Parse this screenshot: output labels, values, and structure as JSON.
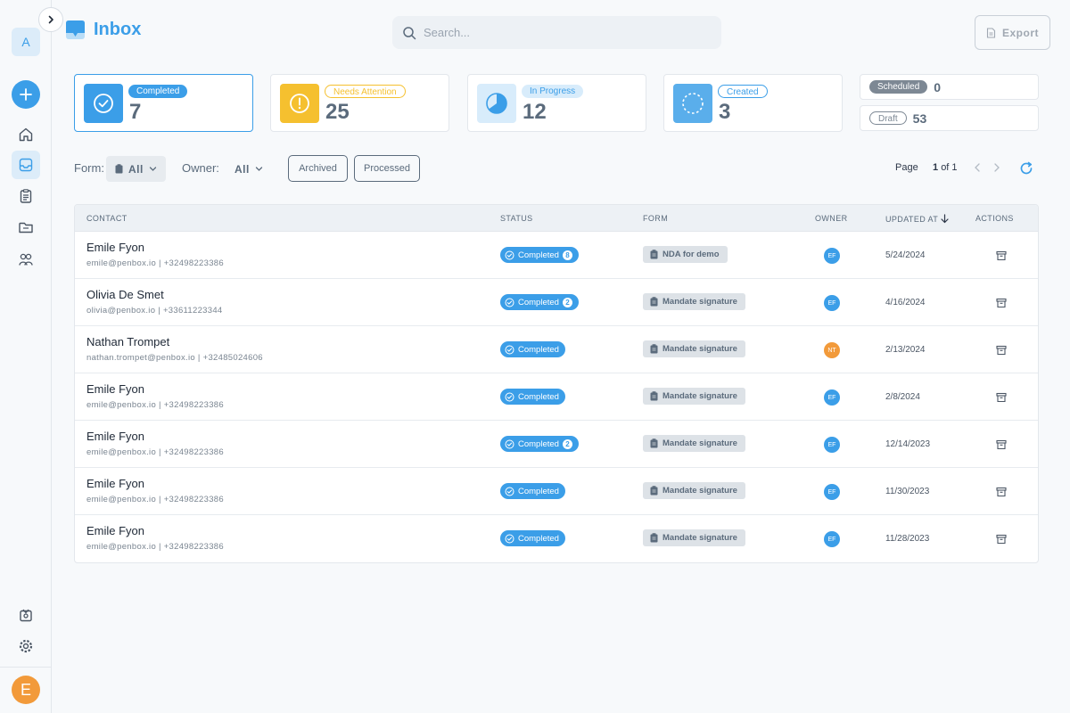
{
  "sidebar": {
    "workspace_initial": "A",
    "user_initial": "E",
    "nav": [
      {
        "icon": "home-icon",
        "name": "nav-home"
      },
      {
        "icon": "inbox-icon",
        "name": "nav-inbox",
        "active": true
      },
      {
        "icon": "clipboard-icon",
        "name": "nav-forms"
      },
      {
        "icon": "folder-icon",
        "name": "nav-files"
      },
      {
        "icon": "contacts-icon",
        "name": "nav-contacts"
      }
    ],
    "bottom": [
      {
        "icon": "gift-icon",
        "name": "nav-gifts"
      },
      {
        "icon": "gear-icon",
        "name": "nav-settings"
      }
    ]
  },
  "header": {
    "title": "Inbox",
    "search_placeholder": "Search...",
    "export_label": "Export"
  },
  "stats": {
    "completed": {
      "label": "Completed",
      "count": "7",
      "color": "#3b9ee8"
    },
    "needs_attention": {
      "label": "Needs Attention",
      "count": "25",
      "color": "#f5c02f"
    },
    "in_progress": {
      "label": "In Progress",
      "count": "12",
      "color": "#5aaeeb"
    },
    "created": {
      "label": "Created",
      "count": "3",
      "color": "#5aaeeb"
    },
    "scheduled": {
      "label": "Scheduled",
      "count": "0"
    },
    "draft": {
      "label": "Draft",
      "count": "53"
    }
  },
  "filters": {
    "form_label": "Form:",
    "form_value": "All",
    "owner_label": "Owner:",
    "owner_value": "All",
    "archived_label": "Archived",
    "processed_label": "Processed",
    "page_label": "Page",
    "page_current": "1",
    "page_of": "of 1"
  },
  "table": {
    "headers": {
      "contact": "CONTACT",
      "status": "STATUS",
      "form": "FORM",
      "owner": "OWNER",
      "updated_at": "UPDATED AT",
      "actions": "ACTIONS"
    },
    "rows": [
      {
        "name": "Emile Fyon",
        "sub": "emile@penbox.io | +32498223386",
        "status": "Completed",
        "badge": "8",
        "form": "NDA for demo",
        "owner": "EF",
        "owner_color": "#3b9ee8",
        "updated": "5/24/2024"
      },
      {
        "name": "Olivia De Smet",
        "sub": "olivia@penbox.io | +33611223344",
        "status": "Completed",
        "badge": "2",
        "form": "Mandate signature",
        "owner": "EF",
        "owner_color": "#3b9ee8",
        "updated": "4/16/2024"
      },
      {
        "name": "Nathan Trompet",
        "sub": "nathan.trompet@penbox.io | +32485024606",
        "status": "Completed",
        "badge": "",
        "form": "Mandate signature",
        "owner": "NT",
        "owner_color": "#f29a3a",
        "updated": "2/13/2024"
      },
      {
        "name": "Emile Fyon",
        "sub": "emile@penbox.io | +32498223386",
        "status": "Completed",
        "badge": "",
        "form": "Mandate signature",
        "owner": "EF",
        "owner_color": "#3b9ee8",
        "updated": "2/8/2024"
      },
      {
        "name": "Emile Fyon",
        "sub": "emile@penbox.io | +32498223386",
        "status": "Completed",
        "badge": "2",
        "form": "Mandate signature",
        "owner": "EF",
        "owner_color": "#3b9ee8",
        "updated": "12/14/2023"
      },
      {
        "name": "Emile Fyon",
        "sub": "emile@penbox.io | +32498223386",
        "status": "Completed",
        "badge": "",
        "form": "Mandate signature",
        "owner": "EF",
        "owner_color": "#3b9ee8",
        "updated": "11/30/2023"
      },
      {
        "name": "Emile Fyon",
        "sub": "emile@penbox.io | +32498223386",
        "status": "Completed",
        "badge": "",
        "form": "Mandate signature",
        "owner": "EF",
        "owner_color": "#3b9ee8",
        "updated": "11/28/2023"
      }
    ]
  }
}
